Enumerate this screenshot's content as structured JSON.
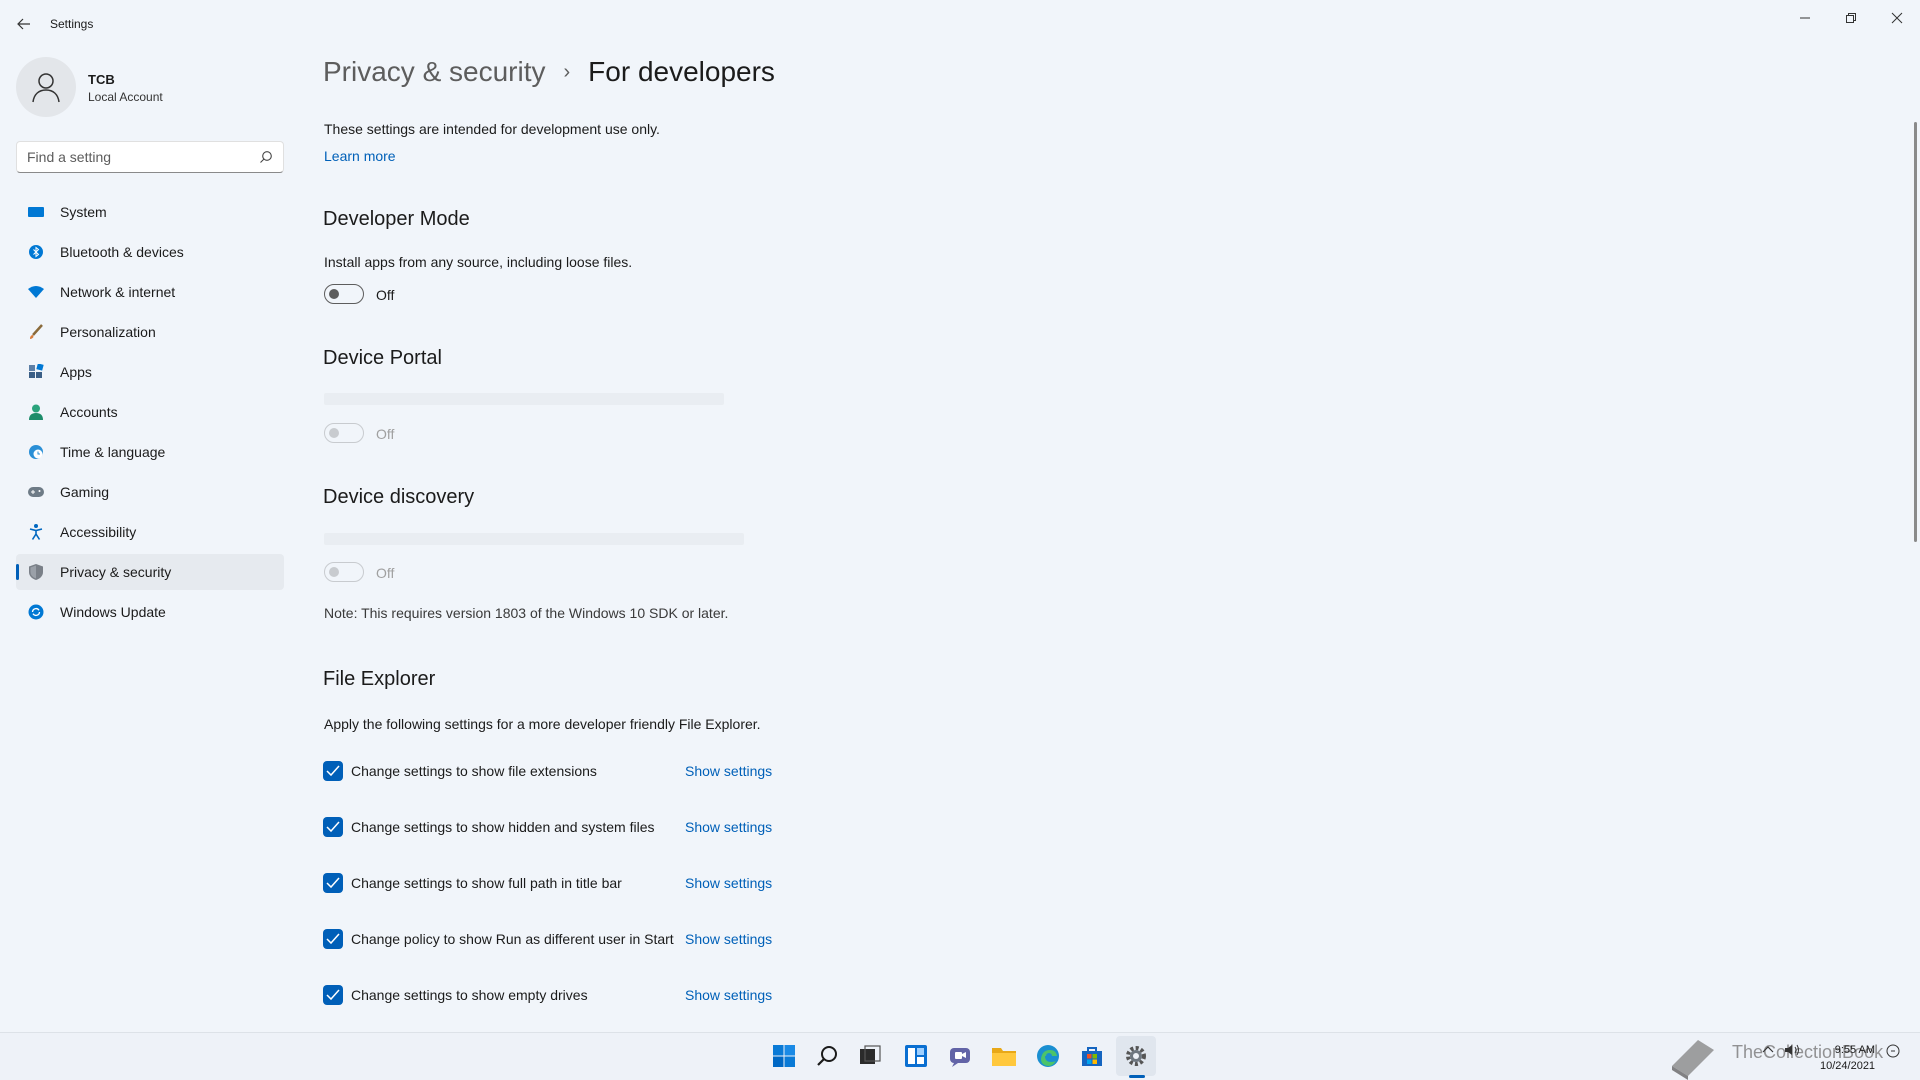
{
  "window": {
    "title": "Settings"
  },
  "user": {
    "name": "TCB",
    "type": "Local Account"
  },
  "search": {
    "placeholder": "Find a setting"
  },
  "sidebar": {
    "items": [
      {
        "label": "System",
        "icon": "monitor-icon"
      },
      {
        "label": "Bluetooth & devices",
        "icon": "bluetooth-icon"
      },
      {
        "label": "Network & internet",
        "icon": "wifi-icon"
      },
      {
        "label": "Personalization",
        "icon": "brush-icon"
      },
      {
        "label": "Apps",
        "icon": "apps-icon"
      },
      {
        "label": "Accounts",
        "icon": "person-icon"
      },
      {
        "label": "Time & language",
        "icon": "globe-clock-icon"
      },
      {
        "label": "Gaming",
        "icon": "gamepad-icon"
      },
      {
        "label": "Accessibility",
        "icon": "accessibility-icon"
      },
      {
        "label": "Privacy & security",
        "icon": "shield-icon",
        "active": true
      },
      {
        "label": "Windows Update",
        "icon": "update-icon"
      }
    ]
  },
  "breadcrumb": {
    "parent": "Privacy & security",
    "separator": "›",
    "current": "For developers"
  },
  "intro": {
    "text": "These settings are intended for development use only.",
    "link": "Learn more"
  },
  "developer_mode": {
    "title": "Developer Mode",
    "description": "Install apps from any source, including loose files.",
    "state": "Off"
  },
  "device_portal": {
    "title": "Device Portal",
    "state": "Off"
  },
  "device_discovery": {
    "title": "Device discovery",
    "state": "Off",
    "note": "Note: This requires version 1803 of the Windows 10 SDK or later."
  },
  "file_explorer": {
    "title": "File Explorer",
    "description": "Apply the following settings for a more developer friendly File Explorer.",
    "link_label": "Show settings",
    "options": [
      {
        "label": "Change settings to show file extensions",
        "checked": true
      },
      {
        "label": "Change settings to show hidden and system files",
        "checked": true
      },
      {
        "label": "Change settings to show full path in title bar",
        "checked": true
      },
      {
        "label": "Change policy to show Run as different user in Start",
        "checked": true
      },
      {
        "label": "Change settings to show empty drives",
        "checked": true
      }
    ]
  },
  "taskbar": {
    "apps": [
      "start-icon",
      "search-icon",
      "task-view-icon",
      "widgets-icon",
      "chat-icon",
      "file-explorer-icon",
      "edge-icon",
      "store-icon",
      "settings-icon"
    ],
    "time": "9:55 AM",
    "date": "10/24/2021",
    "watermark": "TheCollectionBook"
  },
  "colors": {
    "accent": "#005fb8",
    "link": "#0060b8",
    "background": "#f1f5fa"
  }
}
